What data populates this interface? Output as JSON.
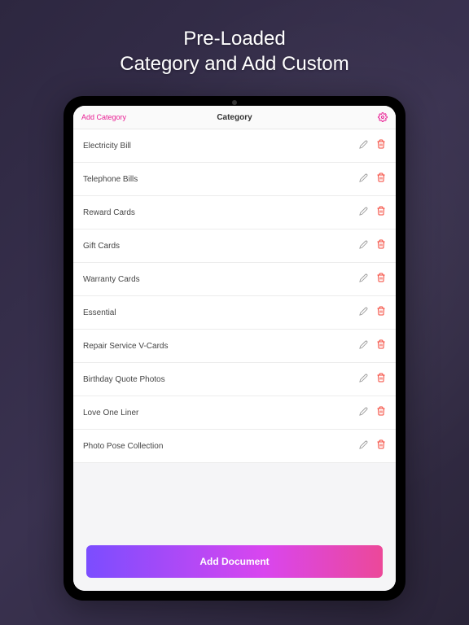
{
  "headline": {
    "line1": "Pre-Loaded",
    "line2": "Category and Add Custom"
  },
  "nav": {
    "add_category": "Add Category",
    "title": "Category"
  },
  "categories": [
    {
      "label": "Electricity Bill"
    },
    {
      "label": "Telephone Bills"
    },
    {
      "label": "Reward Cards"
    },
    {
      "label": "Gift Cards"
    },
    {
      "label": "Warranty Cards"
    },
    {
      "label": "Essential"
    },
    {
      "label": "Repair Service V-Cards"
    },
    {
      "label": "Birthday Quote Photos"
    },
    {
      "label": "Love One Liner"
    },
    {
      "label": "Photo Pose Collection"
    }
  ],
  "buttons": {
    "add_document": "Add Document"
  }
}
